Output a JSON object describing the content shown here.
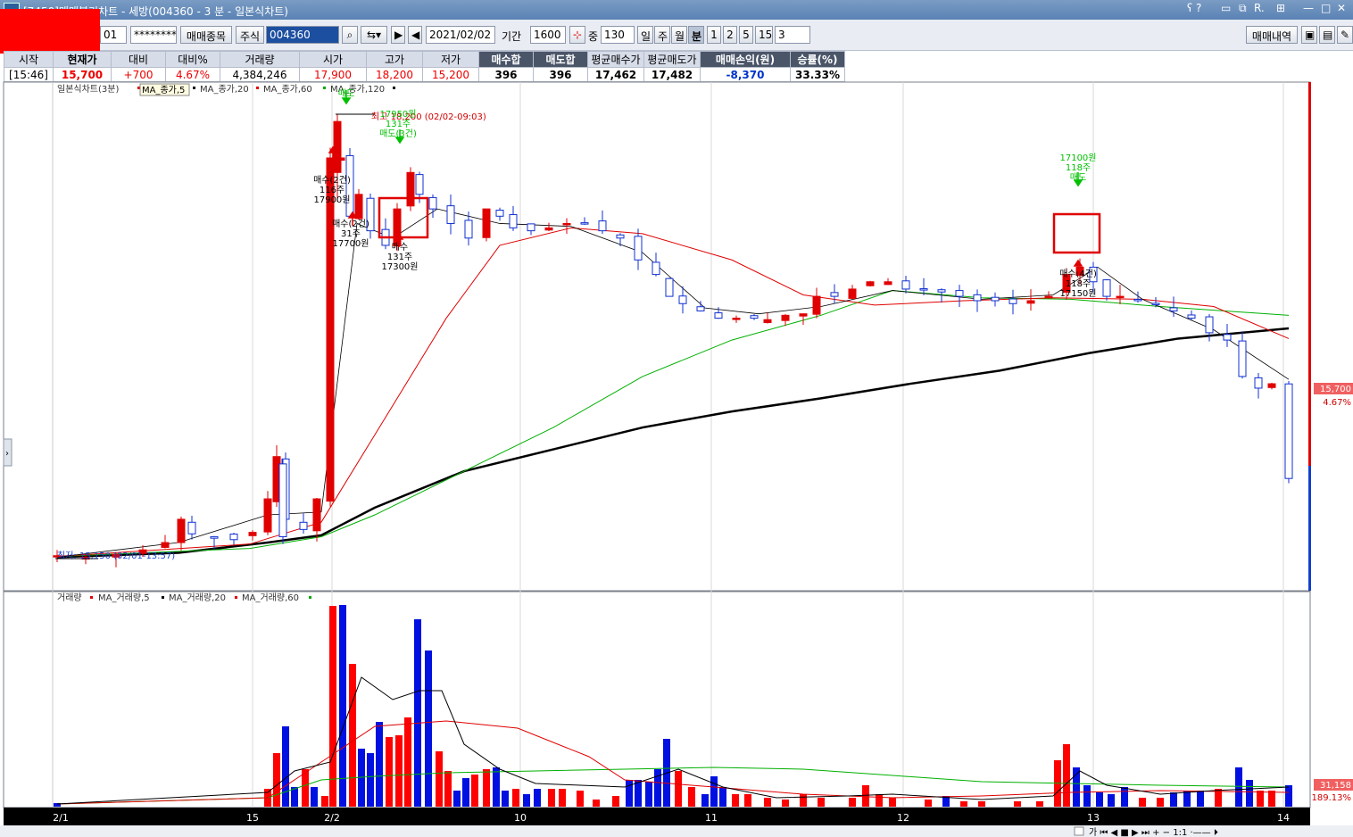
{
  "window": {
    "title": "[7450]매매복기차트 - 세방(004360 - 3 분 - 일본식차트)"
  },
  "toolbar": {
    "account_suffix": "01",
    "password_mask": "********",
    "stock_select_button": "매매종목",
    "market_type": "주식",
    "stock_code": "004360",
    "date": "2021/02/02",
    "period_label": "기간",
    "period_value": "1600",
    "overlap_label": "중",
    "overlap_value": "130",
    "timeframes": [
      "일",
      "주",
      "월",
      "분",
      "1",
      "2",
      "5",
      "15"
    ],
    "active_timeframe": "분",
    "minute_value": "3",
    "trade_history_button": "매매내역"
  },
  "quote": {
    "headers": [
      "시작",
      "현재가",
      "대비",
      "대비%",
      "거래량",
      "시가",
      "고가",
      "저가",
      "매수합",
      "매도합",
      "평균매수가",
      "평균매도가",
      "매매손익(원)",
      "승률(%)"
    ],
    "values": [
      "[15:46]",
      "15,700",
      "+700",
      "4.67%",
      "4,384,246",
      "17,900",
      "18,200",
      "15,200",
      "396",
      "396",
      "17,462",
      "17,482",
      "-8,370",
      "33.33%"
    ]
  },
  "price_panel": {
    "legend": [
      "일본식차트(3분)",
      "MA_종가,5",
      "MA_종가,20",
      "MA_종가,60",
      "MA_종가,120"
    ],
    "legend_colors": [
      "#000000",
      "#e00000",
      "#000000",
      "#e00000",
      "#00aa00",
      "#000000"
    ],
    "high_label": "최고 18,200 (02/02-09:03)",
    "low_label": "최저: 15,150 (02/01-13:57)",
    "last_price_label": "15,700",
    "last_change_label": "4.67%",
    "tooltip": "MA_종가,5"
  },
  "annotations": [
    {
      "lines": [
        "매수(2건)",
        "116주",
        "17900원"
      ],
      "kind": "buy"
    },
    {
      "lines": [
        "매수(2건)",
        "31주",
        "17700원"
      ],
      "kind": "buy"
    },
    {
      "lines": [
        "매수",
        "131주",
        "17300원"
      ],
      "kind": "buy"
    },
    {
      "lines": [
        "17950원",
        "131주",
        "매도(3건)"
      ],
      "kind": "sell"
    },
    {
      "lines": [
        "17100원",
        "118주",
        "매도"
      ],
      "kind": "sell"
    },
    {
      "lines": [
        "매수(4건)",
        "118주",
        "17150원"
      ],
      "kind": "buy"
    },
    {
      "lines": [
        "매도"
      ],
      "kind": "sell"
    }
  ],
  "volume_panel": {
    "legend": [
      "거래량",
      "MA_거래량,5",
      "MA_거래량,20",
      "MA_거래량,60"
    ],
    "legend_colors": [
      "#000000",
      "#e00000",
      "#000000",
      "#e00000",
      "#00aa00"
    ],
    "last_volume_label": "31,158",
    "last_ratio_label": "189.13%"
  },
  "x_axis": {
    "labels": [
      "2/1",
      "15",
      "2/2",
      "10",
      "11",
      "12",
      "13",
      "14"
    ]
  },
  "chart_data": {
    "type": "candlestick",
    "x": [
      "2/1 13:57",
      "2/1 15",
      "2/2 09:00",
      "2/2 10",
      "2/2 11",
      "2/2 12",
      "2/2 13",
      "2/2 14"
    ],
    "y_range": [
      15150,
      18200
    ],
    "open": 17900,
    "high": 18200,
    "low": 15200,
    "close": 15700
  }
}
